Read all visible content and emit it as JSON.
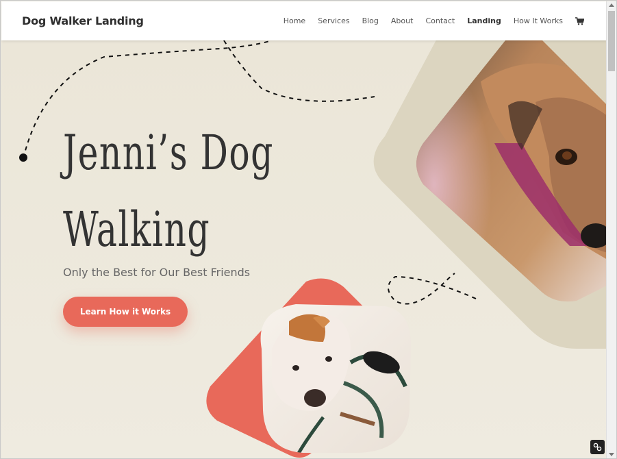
{
  "header": {
    "brand": "Dog Walker Landing",
    "nav": [
      {
        "label": "Home"
      },
      {
        "label": "Services"
      },
      {
        "label": "Blog"
      },
      {
        "label": "About"
      },
      {
        "label": "Contact"
      },
      {
        "label": "Landing"
      },
      {
        "label": "How It Works"
      }
    ],
    "cart_icon": "cart-icon"
  },
  "hero": {
    "title_line1": "Jenni’s Dog",
    "title_line2": "Walking",
    "subtitle": "Only the Best for Our Best Friends",
    "cta_label": "Learn How it Works"
  },
  "colors": {
    "accent": "#e8695a",
    "background": "#ece8dc",
    "frame": "#dcd5c0",
    "text": "#333333"
  },
  "images": {
    "large": "dog-closeup-photo",
    "small": "bulldog-with-leash-photo"
  }
}
